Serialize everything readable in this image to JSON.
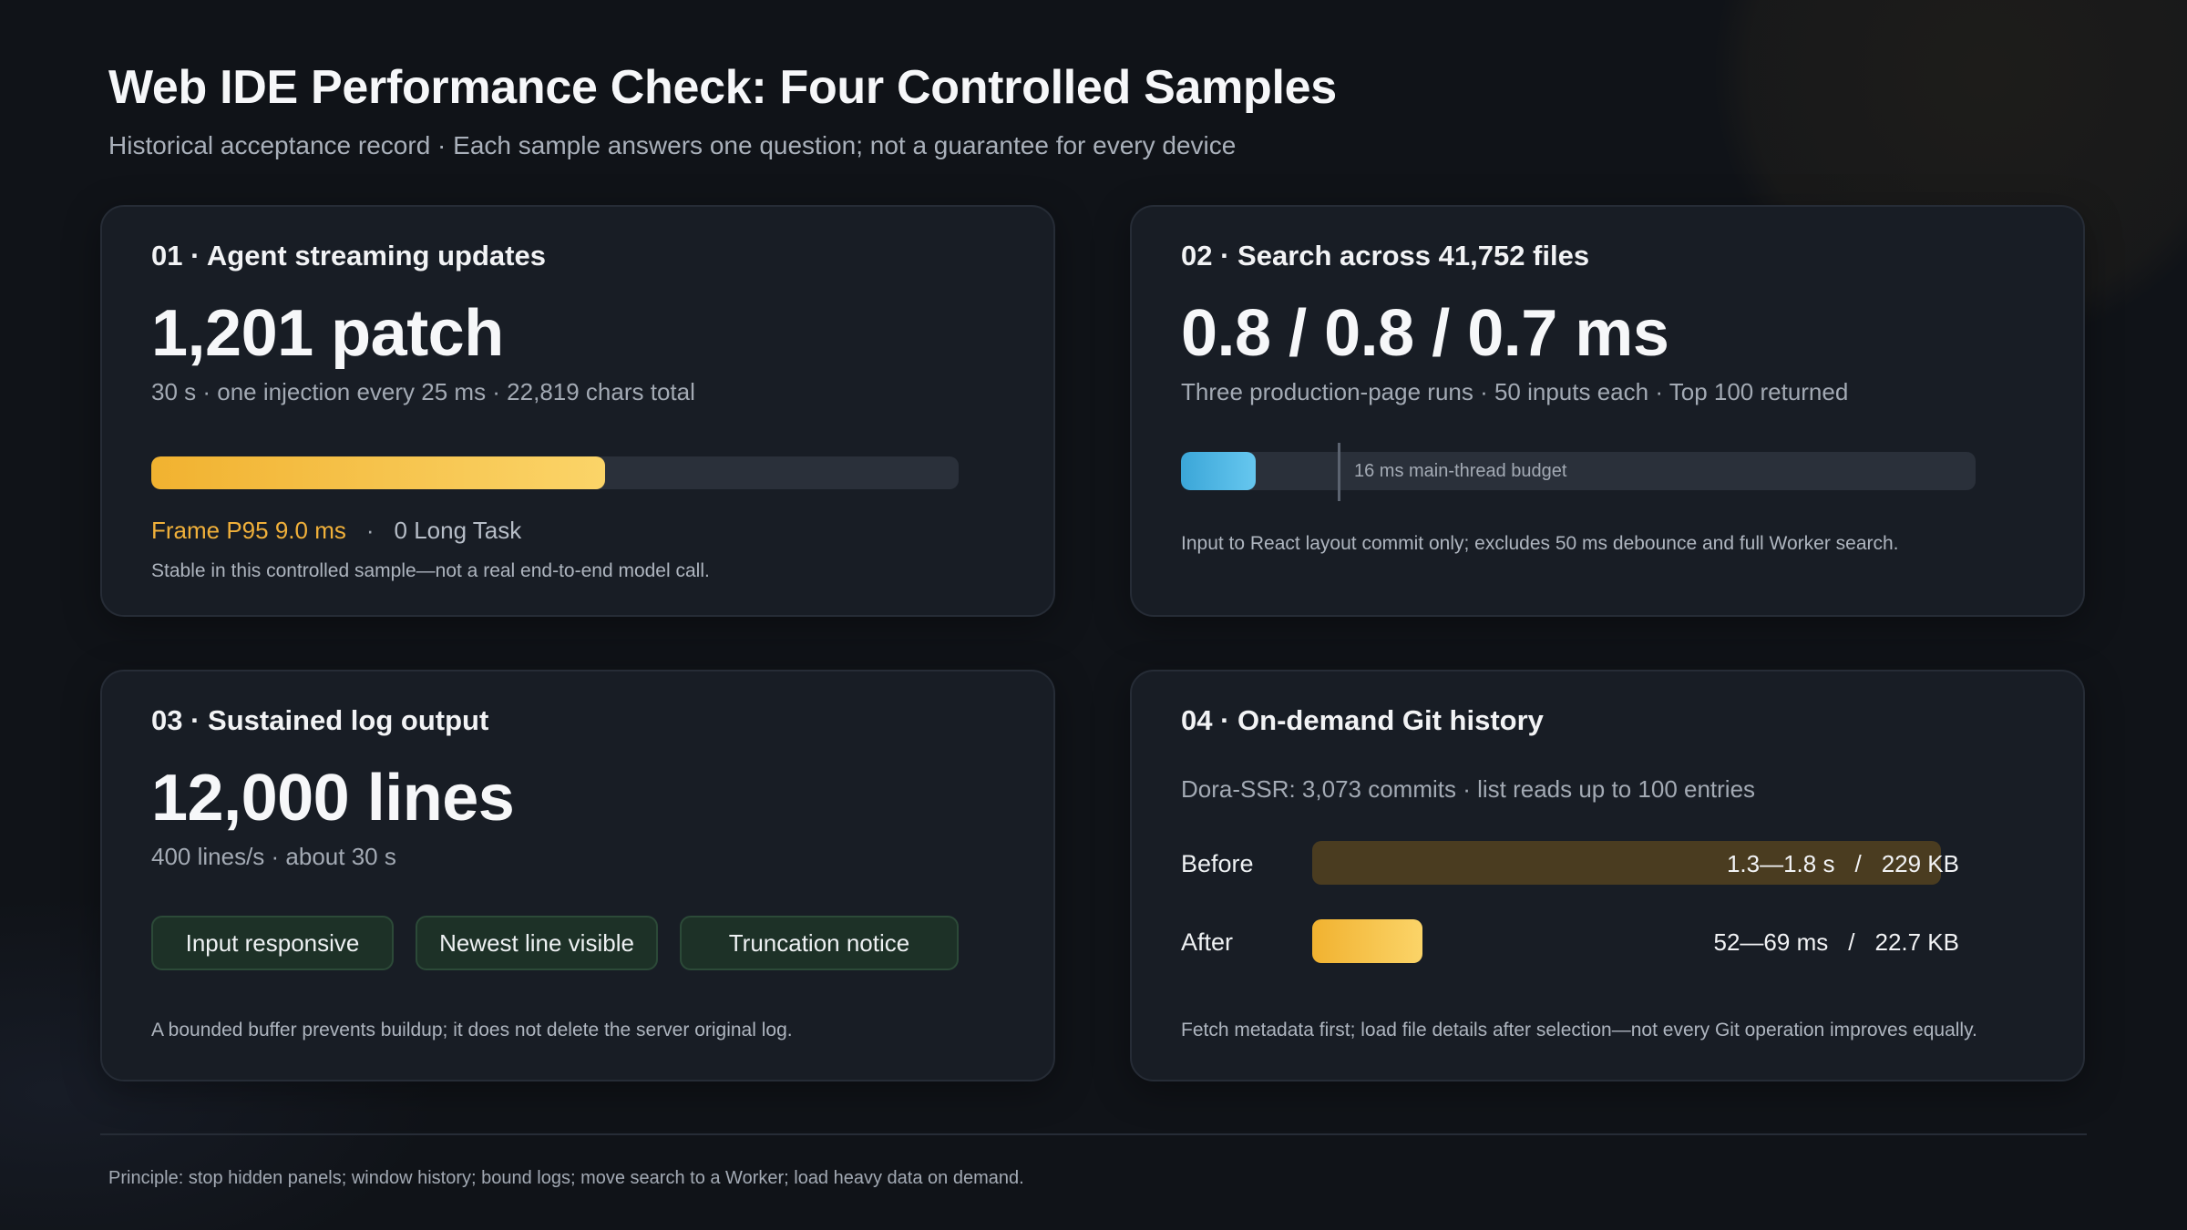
{
  "header": {
    "title": "Web IDE Performance Check: Four Controlled Samples",
    "subtitle": "Historical acceptance record · Each sample answers one question; not a guarantee for every device"
  },
  "cards": [
    {
      "heading": "01 · Agent streaming updates",
      "metric": "1,201 patch",
      "description": "30 s · one injection every 25 ms · 22,819 chars total",
      "progress": 0.562,
      "stat_highlight": "Frame P95 9.0 ms",
      "stat_separator": "·",
      "stat_plain": "0 Long Task",
      "note": "Stable in this controlled sample—not a real end-to-end model call."
    },
    {
      "heading": "02 · Search across 41,752 files",
      "metric": "0.8 / 0.8 / 0.7 ms",
      "description": "Three production-page runs · 50 inputs each · Top 100 returned",
      "measured_ms": 0.8,
      "budget_ms": 16,
      "budget_label": "16 ms main-thread budget",
      "note": "Input to React layout commit only; excludes 50 ms debounce and full Worker search."
    },
    {
      "heading": "03 · Sustained log output",
      "metric": "12,000 lines",
      "description": "400 lines/s · about 30 s",
      "chips": [
        "Input responsive",
        "Newest line visible",
        "Truncation notice"
      ],
      "note": "A bounded buffer prevents buildup; it does not delete the server original log."
    },
    {
      "heading": "04 · On-demand Git history",
      "description": "Dora-SSR: 3,073 commits · list reads up to 100 entries",
      "rows": [
        {
          "label": "Before",
          "value": "1.3—1.8 s",
          "size": "229 KB",
          "fraction": 1.0
        },
        {
          "label": "After",
          "value": "52—69 ms",
          "size": "22.7 KB",
          "fraction": 0.175
        }
      ],
      "slash": "/",
      "note": "Fetch metadata first; load file details after selection—not every Git operation improves equally."
    }
  ],
  "footer": "Principle: stop hidden panels; window history; bound logs; move search to a Worker; load heavy data on demand.",
  "colors": {
    "background": "#101318",
    "card": "#181d25",
    "accent_gold": "#f1b230",
    "accent_blue": "#3ba6d8",
    "chip_green": "#1d3127"
  }
}
